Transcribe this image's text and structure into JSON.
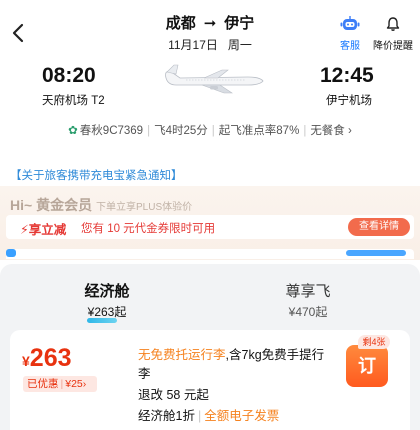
{
  "header": {
    "from_city": "成都",
    "to_city": "伊宁",
    "date": "11月17日",
    "weekday": "周一",
    "service_label": "客服",
    "price_alert_label": "降价提醒"
  },
  "flight": {
    "dep_time": "08:20",
    "dep_airport": "天府机场 T2",
    "arr_time": "12:45",
    "arr_airport": "伊宁机场",
    "airline_flight": "春秋9C7369",
    "duration": "飞4时25分",
    "on_time_rate": "起飞准点率87%",
    "meal": "无餐食"
  },
  "notice": "【关于旅客携带充电宝紧急通知】",
  "member": {
    "title": "Hi~ 黄金会员",
    "subtitle": "下单立享PLUS体验价",
    "promo_tag": "享立减",
    "promo_text": "您有 10 元代金券限时可用",
    "promo_button": "查看详情"
  },
  "tabs": [
    {
      "name": "经济舱",
      "price": "¥263起"
    },
    {
      "name": "尊享飞",
      "price": "¥470起"
    }
  ],
  "offer": {
    "currency": "¥",
    "price": "263",
    "discount_label": "已优惠",
    "discount_value": "¥25",
    "baggage_highlight": "无免费托运行李",
    "baggage_rest": ",含7kg免费手提行李",
    "refund": "退改 58 元起",
    "cabin_class": "经济舱1折",
    "invoice": "全额电子发票",
    "book_label": "订",
    "remaining": "剩4张"
  },
  "colors": {
    "accent_blue": "#1677ff",
    "price_red": "#e8320f",
    "highlight_orange": "#f5821f"
  }
}
